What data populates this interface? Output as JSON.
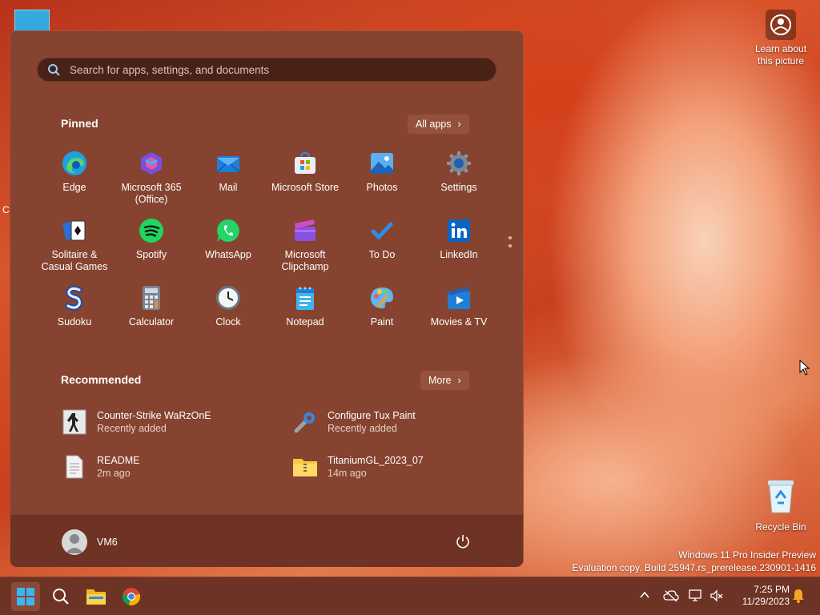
{
  "desktop": {
    "edge_text": "C",
    "learn_label": "Learn about this picture",
    "recycle_label": "Recycle Bin",
    "watermark_line1": "Windows 11 Pro Insider Preview",
    "watermark_line2": "Evaluation copy. Build 25947.rs_prerelease.230901-1416"
  },
  "start": {
    "search_placeholder": "Search for apps, settings, and documents",
    "pinned_title": "Pinned",
    "all_apps_label": "All apps",
    "pinned": [
      {
        "label": "Edge",
        "icon": "edge-icon"
      },
      {
        "label": "Microsoft 365 (Office)",
        "icon": "microsoft-365-icon"
      },
      {
        "label": "Mail",
        "icon": "mail-icon"
      },
      {
        "label": "Microsoft Store",
        "icon": "store-icon"
      },
      {
        "label": "Photos",
        "icon": "photos-icon"
      },
      {
        "label": "Settings",
        "icon": "gear-icon"
      },
      {
        "label": "Solitaire & Casual Games",
        "icon": "solitaire-icon"
      },
      {
        "label": "Spotify",
        "icon": "spotify-icon"
      },
      {
        "label": "WhatsApp",
        "icon": "whatsapp-icon"
      },
      {
        "label": "Microsoft Clipchamp",
        "icon": "clipchamp-icon"
      },
      {
        "label": "To Do",
        "icon": "todo-check-icon"
      },
      {
        "label": "LinkedIn",
        "icon": "linkedin-icon"
      },
      {
        "label": "Sudoku",
        "icon": "sudoku-icon"
      },
      {
        "label": "Calculator",
        "icon": "calculator-icon"
      },
      {
        "label": "Clock",
        "icon": "clock-icon"
      },
      {
        "label": "Notepad",
        "icon": "notepad-icon"
      },
      {
        "label": "Paint",
        "icon": "paint-icon"
      },
      {
        "label": "Movies & TV",
        "icon": "movies-tv-icon"
      }
    ],
    "recommended_title": "Recommended",
    "more_label": "More",
    "recommended": [
      {
        "title": "Counter-Strike WaRzOnE",
        "sub": "Recently added",
        "icon": "counter-strike-icon"
      },
      {
        "title": "Configure Tux Paint",
        "sub": "Recently added",
        "icon": "wrench-icon"
      },
      {
        "title": "README",
        "sub": "2m ago",
        "icon": "document-icon"
      },
      {
        "title": "TitaniumGL_2023_07",
        "sub": "14m ago",
        "icon": "zip-folder-icon"
      }
    ],
    "user_name": "VM6"
  },
  "taskbar": {
    "time": "7:25 PM",
    "date": "11/29/2023"
  },
  "colors": {
    "start_bg": "#86432f",
    "taskbar_bg": "#6d3324",
    "accent_blue": "#2f8de4"
  }
}
